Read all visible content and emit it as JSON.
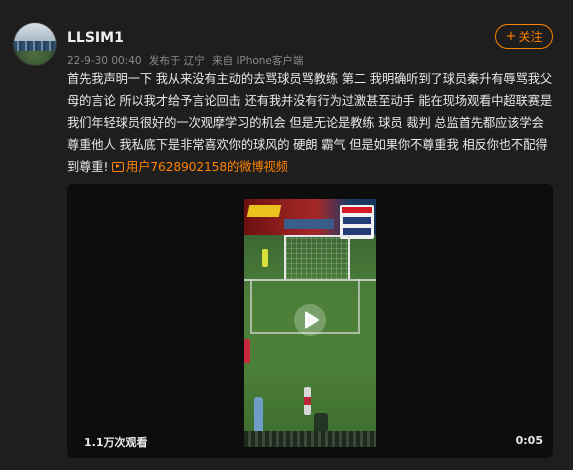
{
  "user": {
    "name": "LLSIM1",
    "avatar_icon": "football-stadium-avatar"
  },
  "meta": {
    "date": "22-9-30 00:40",
    "location": "发布于 辽宁",
    "source": "来自 iPhone客户端"
  },
  "follow_button": {
    "icon": "+",
    "label": "关注"
  },
  "post": {
    "text": "首先我声明一下 我从来没有主动的去骂球员骂教练 第二 我明确听到了球员秦升有辱骂我父母的言论 所以我才给予言论回击 还有我并没有行为过激甚至动手 能在现场观看中超联赛是我们年轻球员很好的一次观摩学习的机会 但是无论是教练 球员 裁判 总监首先都应该学会尊重他人 我私底下是非常喜欢你的球风的 硬朗 霸气 但是如果你不尊重我 相反你也不配得到尊重!",
    "video_link": "用户7628902158的微博视频"
  },
  "player": {
    "views": "1.1万次观看",
    "duration": "0:05",
    "play_icon": "play-icon"
  },
  "colors": {
    "accent": "#ff8200",
    "background": "#1e1e1e",
    "player_bg": "#0d0d0d"
  }
}
